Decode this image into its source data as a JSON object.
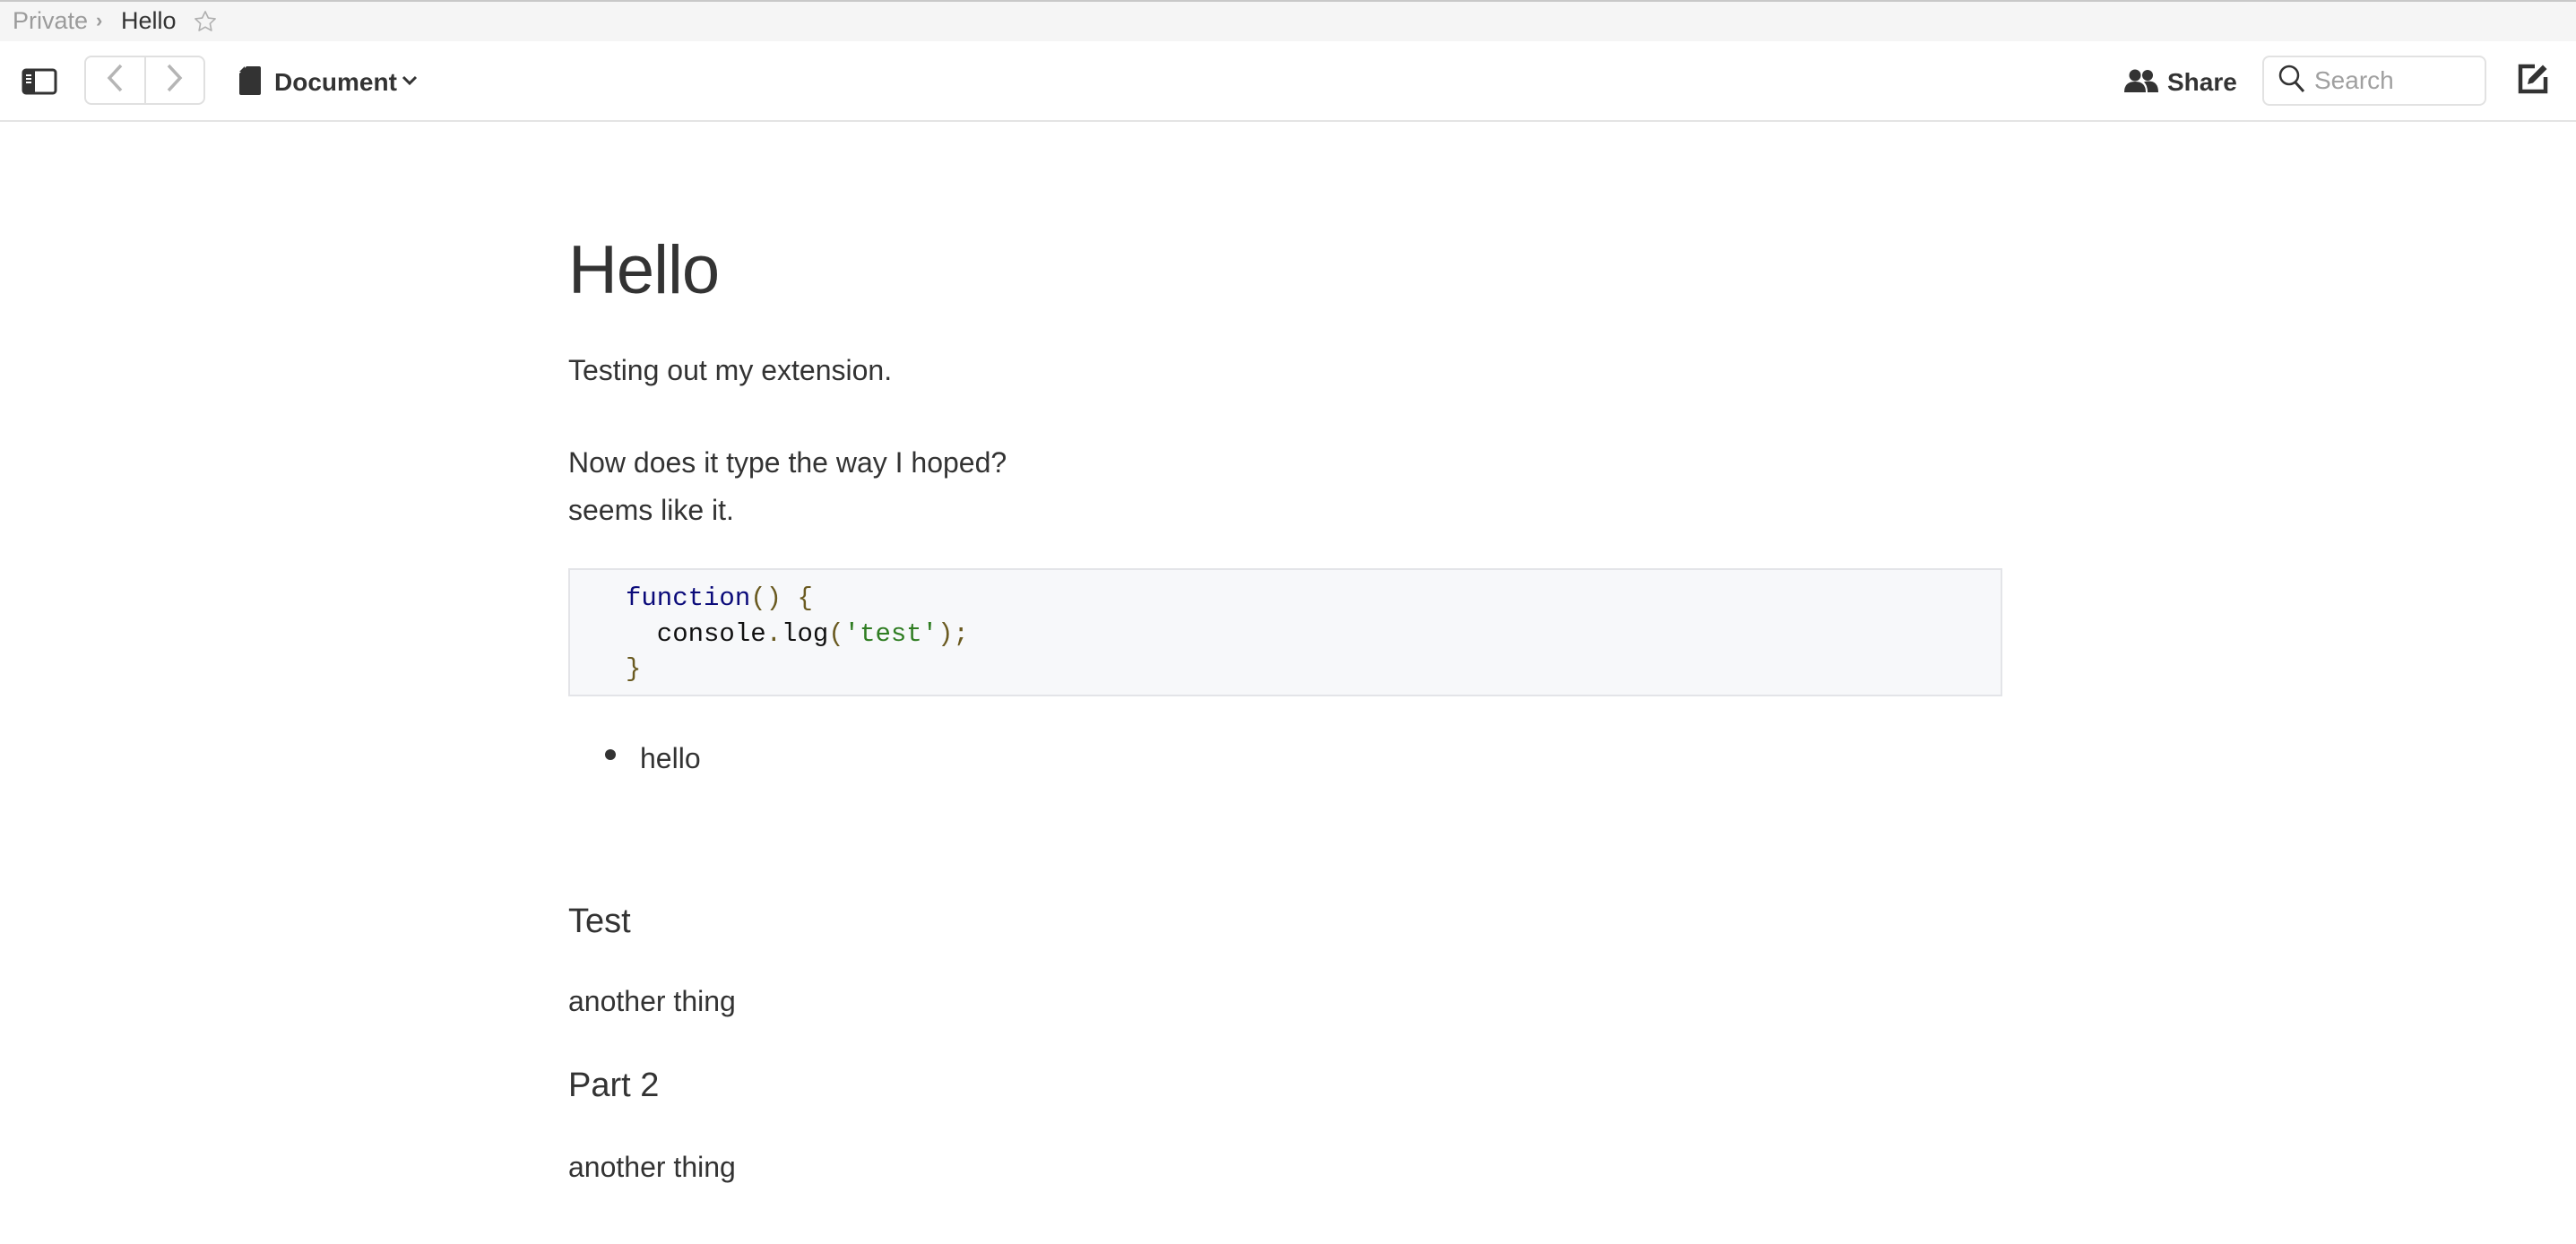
{
  "breadcrumb": {
    "items": [
      "Private",
      "Hello"
    ],
    "separator": "›",
    "favorite_icon": "star-outline-icon"
  },
  "toolbar": {
    "sidebar_toggle_icon": "sidebar-toggle-icon",
    "back_icon": "chevron-left-icon",
    "forward_icon": "chevron-right-icon",
    "document_menu": {
      "icon": "document-icon",
      "label": "Document",
      "chevron": "chevron-down-icon"
    },
    "share": {
      "icon": "users-icon",
      "label": "Share"
    },
    "search": {
      "icon": "search-icon",
      "placeholder": "Search",
      "value": ""
    },
    "compose_icon": "compose-icon"
  },
  "document": {
    "title": "Hello",
    "paragraphs": [
      "Testing out my extension.",
      "Now does it type the way I hoped?",
      "seems like it."
    ],
    "code": {
      "lines": [
        [
          {
            "t": "kw",
            "v": "function"
          },
          {
            "t": "punc",
            "v": "()"
          },
          {
            "t": "plain",
            "v": " "
          },
          {
            "t": "punc",
            "v": "{"
          }
        ],
        [
          {
            "t": "plain",
            "v": "  console"
          },
          {
            "t": "punc",
            "v": "."
          },
          {
            "t": "plain",
            "v": "log"
          },
          {
            "t": "punc",
            "v": "("
          },
          {
            "t": "str",
            "v": "'test'"
          },
          {
            "t": "punc",
            "v": ");"
          }
        ],
        [
          {
            "t": "punc",
            "v": "}"
          }
        ]
      ]
    },
    "list": [
      "hello"
    ],
    "sections": [
      {
        "heading": "Test",
        "body": "another thing"
      },
      {
        "heading": "Part 2",
        "body": "another thing"
      }
    ]
  },
  "colors": {
    "text": "#333333",
    "muted": "#9b9b9b",
    "code_bg": "#f7f8fa",
    "code_keyword": "#0b0b7a",
    "code_punctuation": "#6a5a20",
    "code_string": "#2f7d22"
  }
}
